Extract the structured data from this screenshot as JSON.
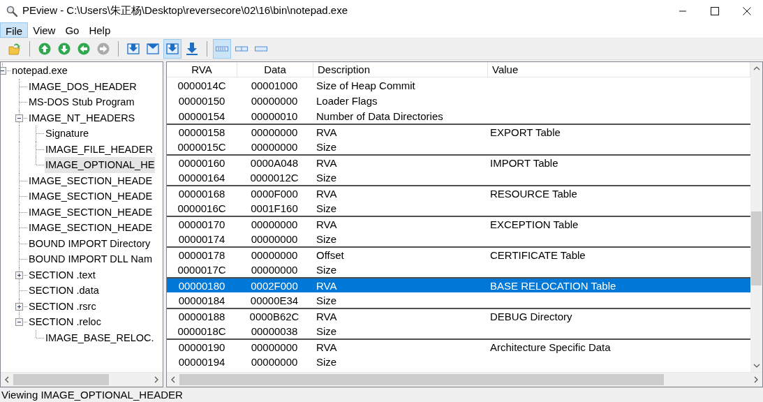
{
  "window": {
    "title": "PEview - C:\\Users\\朱正杨\\Desktop\\reversecore\\02\\16\\bin\\notepad.exe"
  },
  "menu": [
    {
      "label": "File",
      "selected": true
    },
    {
      "label": "View",
      "selected": false
    },
    {
      "label": "Go",
      "selected": false
    },
    {
      "label": "Help",
      "selected": false
    }
  ],
  "toolbar": [
    {
      "buttons": [
        {
          "kind": "folder",
          "pressed": false,
          "disabled": false
        }
      ]
    },
    {
      "buttons": [
        {
          "kind": "arrow-up",
          "pressed": false,
          "disabled": false
        },
        {
          "kind": "arrow-down",
          "pressed": false,
          "disabled": false
        },
        {
          "kind": "arrow-left",
          "pressed": false,
          "disabled": false
        },
        {
          "kind": "arrow-right",
          "pressed": false,
          "disabled": true
        }
      ]
    },
    {
      "buttons": [
        {
          "kind": "tray-arrow",
          "pressed": false,
          "disabled": false
        },
        {
          "kind": "tray",
          "pressed": false,
          "disabled": false
        },
        {
          "kind": "tray-arrow",
          "pressed": true,
          "disabled": false
        },
        {
          "kind": "arrow-to-bar",
          "pressed": false,
          "disabled": false
        }
      ]
    },
    {
      "buttons": [
        {
          "kind": "view-bytes",
          "pressed": true,
          "disabled": false
        },
        {
          "kind": "view-words",
          "pressed": false,
          "disabled": false
        },
        {
          "kind": "view-dwords",
          "pressed": false,
          "disabled": false
        }
      ]
    }
  ],
  "tree": [
    {
      "label": "notepad.exe",
      "selected": false,
      "expanded": true,
      "children": [
        {
          "label": "IMAGE_DOS_HEADER",
          "selected": false
        },
        {
          "label": "MS-DOS Stub Program",
          "selected": false
        },
        {
          "label": "IMAGE_NT_HEADERS",
          "selected": false,
          "expanded": true,
          "children": [
            {
              "label": "Signature",
              "selected": false
            },
            {
              "label": "IMAGE_FILE_HEADER",
              "selected": false
            },
            {
              "label": "IMAGE_OPTIONAL_HE",
              "selected": true
            }
          ]
        },
        {
          "label": "IMAGE_SECTION_HEADE",
          "selected": false
        },
        {
          "label": "IMAGE_SECTION_HEADE",
          "selected": false
        },
        {
          "label": "IMAGE_SECTION_HEADE",
          "selected": false
        },
        {
          "label": "IMAGE_SECTION_HEADE",
          "selected": false
        },
        {
          "label": "BOUND IMPORT Directory",
          "selected": false
        },
        {
          "label": "BOUND IMPORT DLL Nam",
          "selected": false
        },
        {
          "label": "SECTION .text",
          "selected": false,
          "expanded": false
        },
        {
          "label": "SECTION .data",
          "selected": false
        },
        {
          "label": "SECTION .rsrc",
          "selected": false,
          "expanded": false
        },
        {
          "label": "SECTION .reloc",
          "selected": false,
          "expanded": true,
          "children": [
            {
              "label": "IMAGE_BASE_RELOC.",
              "selected": false
            }
          ]
        }
      ]
    }
  ],
  "table": {
    "columns": [
      "RVA",
      "Data",
      "Description",
      "Value"
    ],
    "rows": [
      {
        "rva": "0000014C",
        "data": "00001000",
        "description": "Size of Heap Commit",
        "selected": false,
        "group_start": false
      },
      {
        "rva": "00000150",
        "data": "00000000",
        "description": "Loader Flags",
        "selected": false,
        "group_start": false
      },
      {
        "rva": "00000154",
        "data": "00000010",
        "description": "Number of Data Directories",
        "selected": false,
        "group_start": false
      },
      {
        "rva": "00000158",
        "data": "00000000",
        "description": "RVA",
        "value": "EXPORT Table",
        "selected": false,
        "group_start": true
      },
      {
        "rva": "0000015C",
        "data": "00000000",
        "description": "Size",
        "selected": false,
        "group_start": false
      },
      {
        "rva": "00000160",
        "data": "0000A048",
        "description": "RVA",
        "value": "IMPORT Table",
        "selected": false,
        "group_start": true
      },
      {
        "rva": "00000164",
        "data": "0000012C",
        "description": "Size",
        "selected": false,
        "group_start": false
      },
      {
        "rva": "00000168",
        "data": "0000F000",
        "description": "RVA",
        "value": "RESOURCE Table",
        "selected": false,
        "group_start": true
      },
      {
        "rva": "0000016C",
        "data": "0001F160",
        "description": "Size",
        "selected": false,
        "group_start": false
      },
      {
        "rva": "00000170",
        "data": "00000000",
        "description": "RVA",
        "value": "EXCEPTION Table",
        "selected": false,
        "group_start": true
      },
      {
        "rva": "00000174",
        "data": "00000000",
        "description": "Size",
        "selected": false,
        "group_start": false
      },
      {
        "rva": "00000178",
        "data": "00000000",
        "description": "Offset",
        "value": "CERTIFICATE Table",
        "selected": false,
        "group_start": true
      },
      {
        "rva": "0000017C",
        "data": "00000000",
        "description": "Size",
        "selected": false,
        "group_start": false
      },
      {
        "rva": "00000180",
        "data": "0002F000",
        "description": "RVA",
        "value": "BASE RELOCATION Table",
        "selected": true,
        "group_start": true
      },
      {
        "rva": "00000184",
        "data": "00000E34",
        "description": "Size",
        "selected": false,
        "group_start": false
      },
      {
        "rva": "00000188",
        "data": "0000B62C",
        "description": "RVA",
        "value": "DEBUG Directory",
        "selected": false,
        "group_start": true
      },
      {
        "rva": "0000018C",
        "data": "00000038",
        "description": "Size",
        "selected": false,
        "group_start": false
      },
      {
        "rva": "00000190",
        "data": "00000000",
        "description": "RVA",
        "value": "Architecture Specific Data",
        "selected": false,
        "group_start": true
      },
      {
        "rva": "00000194",
        "data": "00000000",
        "description": "Size",
        "selected": false,
        "group_start": false
      }
    ]
  },
  "status_bar": "Viewing IMAGE_OPTIONAL_HEADER"
}
